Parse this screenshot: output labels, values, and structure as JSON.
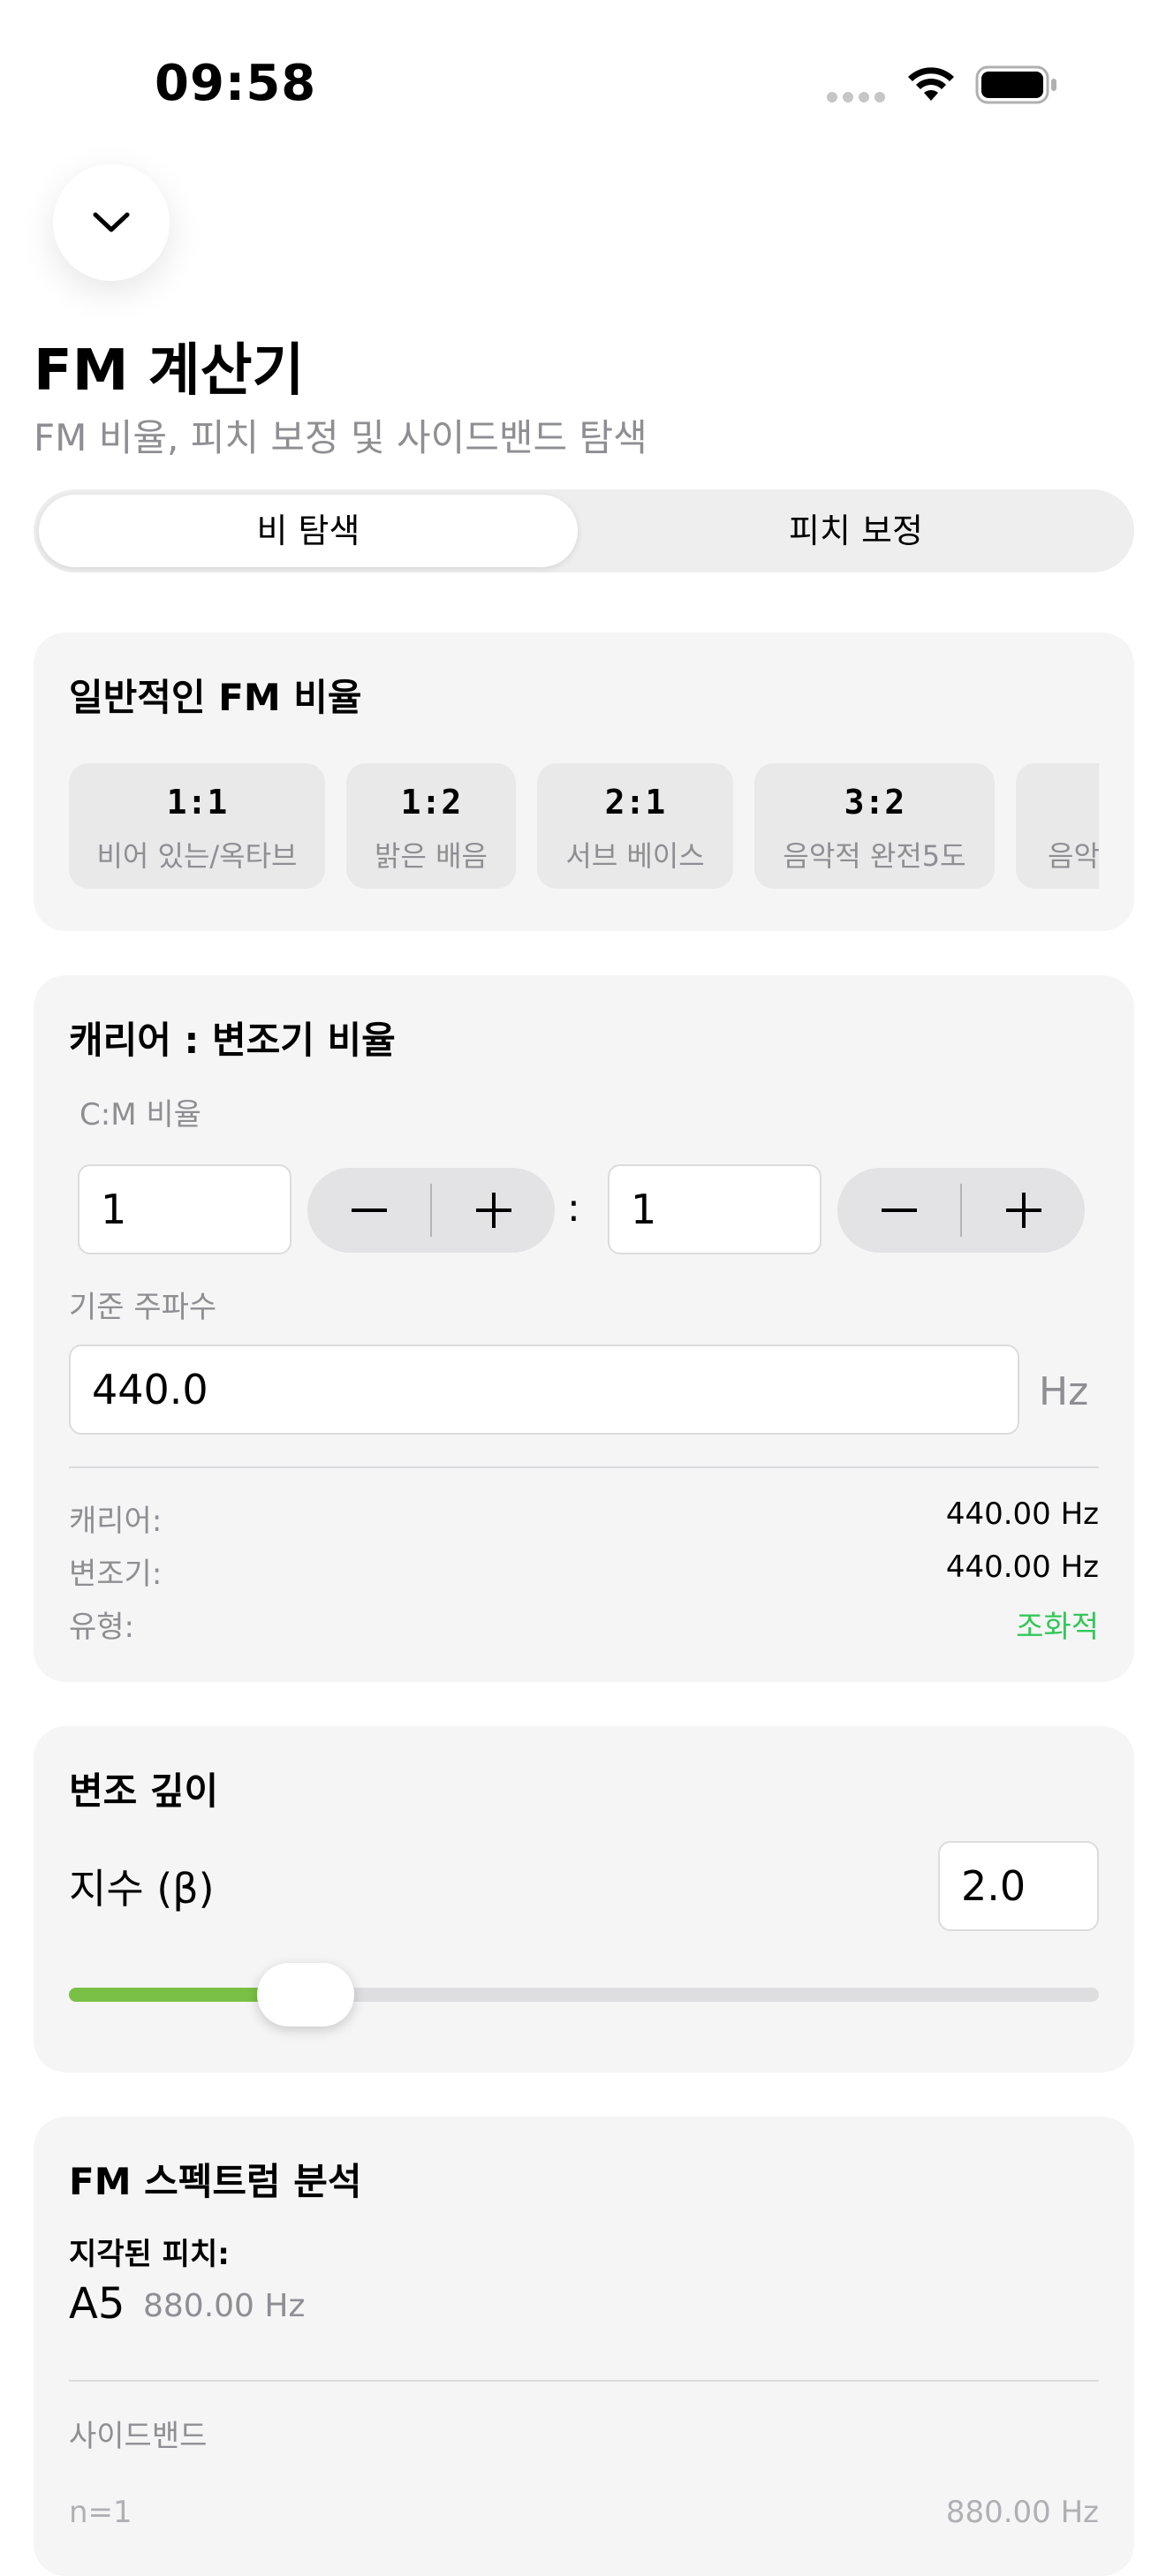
{
  "status_bar": {
    "time": "09:58"
  },
  "header": {
    "title": "FM 계산기",
    "subtitle": "FM 비율, 피치 보정 및 사이드밴드 탐색"
  },
  "tabs": [
    {
      "label": "비 탐색",
      "selected": true
    },
    {
      "label": "피치 보정",
      "selected": false
    }
  ],
  "common_ratios": {
    "title": "일반적인 FM 비율",
    "items": [
      {
        "ratio": "1:1",
        "desc": "비어 있는/옥타브"
      },
      {
        "ratio": "1:2",
        "desc": "밝은 배음"
      },
      {
        "ratio": "2:1",
        "desc": "서브 베이스"
      },
      {
        "ratio": "3:2",
        "desc": "음악적 완전5도"
      },
      {
        "ratio": "",
        "desc": "음악"
      }
    ]
  },
  "cm_ratio": {
    "title": "캐리어 : 변조기 비율",
    "ratio_label": "C:M 비율",
    "carrier_value": "1",
    "modulator_value": "1",
    "separator": ":",
    "base_freq_label": "기준 주파수",
    "base_freq_value": "440.0",
    "base_freq_unit": "Hz",
    "results": [
      {
        "key": "캐리어:",
        "value": "440.00 Hz"
      },
      {
        "key": "변조기:",
        "value": "440.00 Hz"
      },
      {
        "key": "유형:",
        "value": "조화적"
      }
    ]
  },
  "mod_depth": {
    "title": "변조 깊이",
    "index_label": "지수 (β)",
    "index_value": "2.0",
    "slider_fraction": 0.23
  },
  "spectrum": {
    "title": "FM 스펙트럼 분석",
    "perceived_label": "지각된 피치:",
    "note": "A5",
    "note_freq": "880.00 Hz",
    "sidebands_label": "사이드밴드",
    "sideband_rows": [
      {
        "n": "n=1",
        "freq": "880.00 Hz"
      }
    ]
  },
  "colors": {
    "accent_green": "#34c759",
    "slider_green": "#7ac045",
    "card_bg": "#f5f5f6",
    "secondary_text": "#8e8e93"
  }
}
